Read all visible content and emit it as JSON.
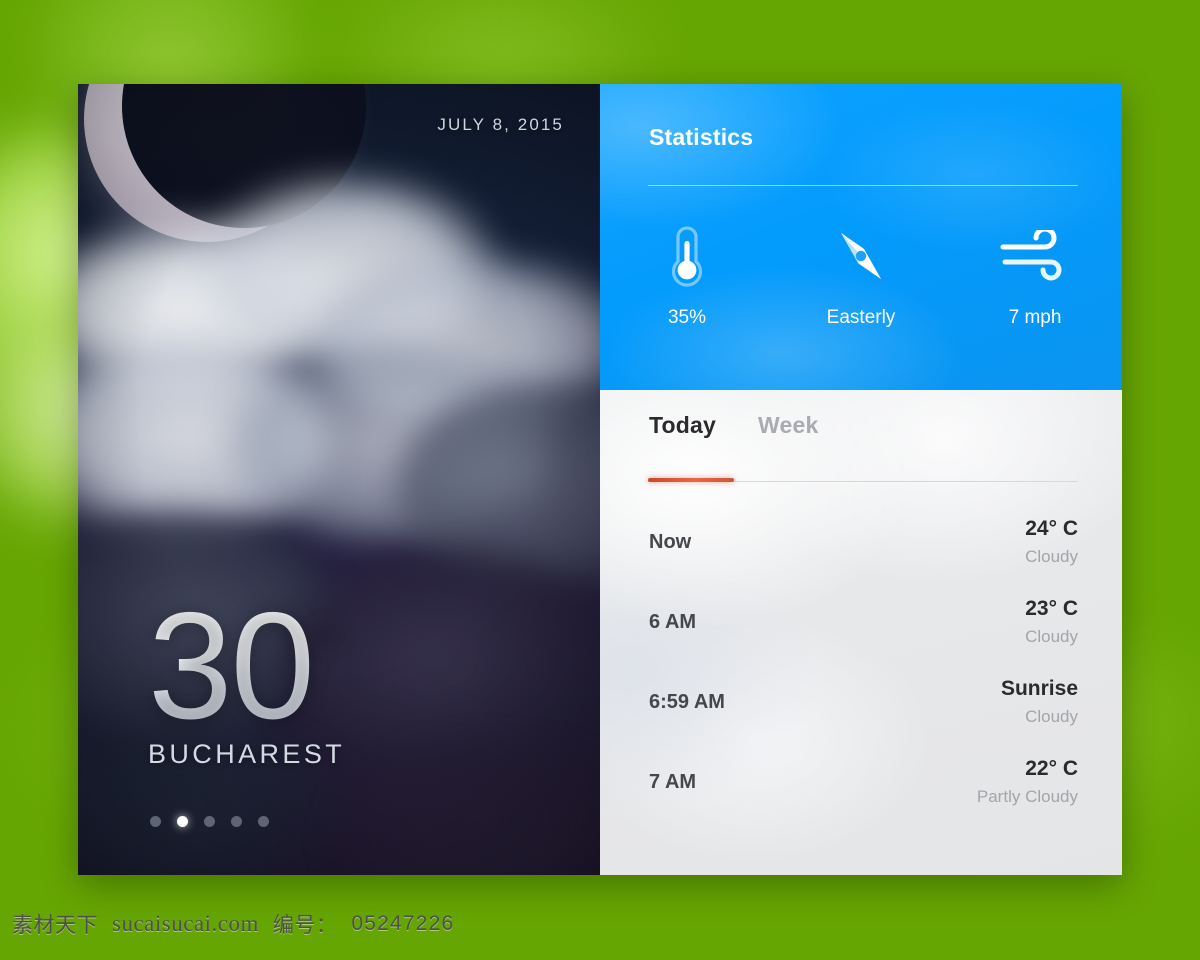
{
  "hero": {
    "date": "JULY 8, 2015",
    "temperature": "30",
    "degree_symbol": "°",
    "city": "BUCHAREST",
    "icon": "crescent-moon-cloudy",
    "pagination": {
      "total": 5,
      "active_index": 1
    }
  },
  "statistics": {
    "title": "Statistics",
    "accent_color": "#039bfc",
    "items": [
      {
        "icon": "thermometer-icon",
        "label": "35%"
      },
      {
        "icon": "compass-icon",
        "label": "Easterly"
      },
      {
        "icon": "wind-icon",
        "label": "7 mph"
      }
    ]
  },
  "forecast": {
    "tabs": [
      {
        "label": "Today",
        "active": true
      },
      {
        "label": "Week",
        "active": false
      }
    ],
    "active_indicator_color": "#d24f32",
    "rows": [
      {
        "time": "Now",
        "temp": "24° C",
        "condition": "Cloudy"
      },
      {
        "time": "6 AM",
        "temp": "23° C",
        "condition": "Cloudy"
      },
      {
        "time": "6:59 AM",
        "temp": "Sunrise",
        "condition": "Cloudy"
      },
      {
        "time": "7 AM",
        "temp": "22° C",
        "condition": "Partly Cloudy"
      }
    ]
  },
  "watermark": {
    "brand": "素材天下",
    "site": "sucaisucai.com",
    "id_label": "编号：",
    "id_value": "05247226"
  },
  "background": {
    "color": "#66a603"
  }
}
